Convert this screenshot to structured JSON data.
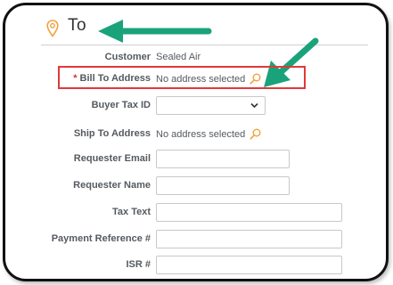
{
  "header": {
    "title": "To",
    "icon": "map-pin-icon"
  },
  "fields": {
    "customer": {
      "label": "Customer",
      "value": "Sealed Air"
    },
    "bill_to_address": {
      "required_marker": "*",
      "label": "Bill To Address",
      "value": "No address selected",
      "icon": "search-icon"
    },
    "buyer_tax_id": {
      "label": "Buyer Tax ID",
      "value": ""
    },
    "ship_to_address": {
      "label": "Ship To Address",
      "value": "No address selected",
      "icon": "search-icon"
    },
    "requester_email": {
      "label": "Requester Email",
      "value": ""
    },
    "requester_name": {
      "label": "Requester Name",
      "value": ""
    },
    "tax_text": {
      "label": "Tax Text",
      "value": ""
    },
    "payment_reference": {
      "label": "Payment Reference #",
      "value": ""
    },
    "isr": {
      "label": "ISR #",
      "value": ""
    }
  },
  "colors": {
    "accent_arrow": "#1aa37a",
    "highlight": "#e0393a",
    "pin": "#f0a33e",
    "search": "#f0a33e"
  }
}
